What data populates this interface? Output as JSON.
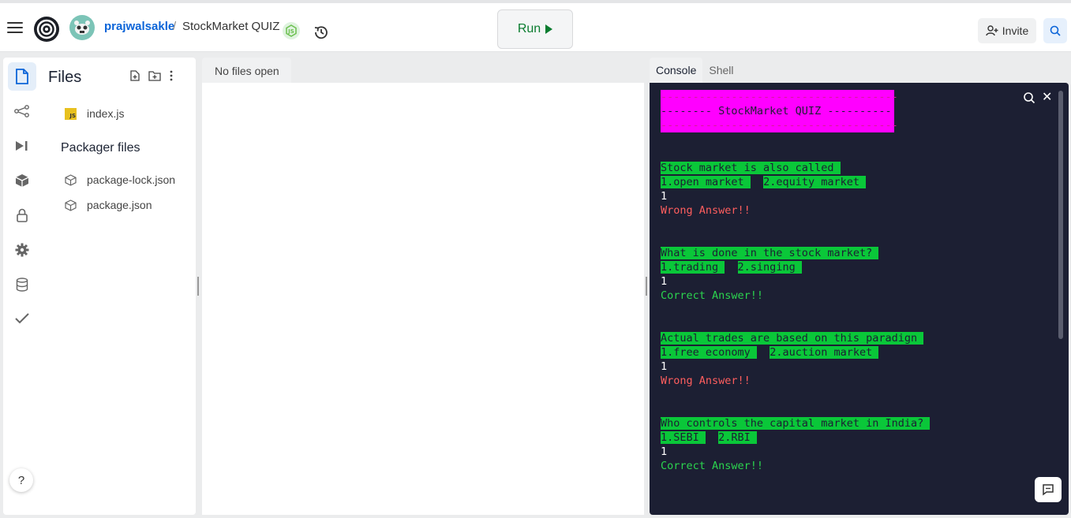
{
  "topbar": {
    "username": "prajwalsakle",
    "separator": "/",
    "project_name": "StockMarket QUIZ",
    "run_label": "Run",
    "invite_label": "Invite",
    "icons": [
      "menu-icon",
      "replit-logo",
      "nodejs-icon",
      "history-icon",
      "play-icon",
      "add-user-icon",
      "search-icon"
    ]
  },
  "sidebar": {
    "title": "Files",
    "rail_icons": [
      "file-icon",
      "share-icon",
      "debugger-icon",
      "packages-icon",
      "lock-icon",
      "gear-icon",
      "database-icon",
      "check-icon"
    ],
    "files": [
      {
        "name": "index.js",
        "icon": "js-icon"
      }
    ],
    "packager_title": "Packager files",
    "packager_files": [
      {
        "name": "package-lock.json",
        "icon": "cube-icon"
      },
      {
        "name": "package.json",
        "icon": "cube-icon"
      }
    ],
    "help_label": "?"
  },
  "editor": {
    "tab_label": "No files open"
  },
  "console": {
    "tabs": [
      "Console",
      "Shell"
    ],
    "active_tab": "Console",
    "header_lines": [
      "-------------------------------------",
      "-------- StockMarket QUIZ ----------",
      "-------------------------------------"
    ],
    "questions": [
      {
        "question": "Stock market is also called ",
        "opt1": "1.open market ",
        "opt2": "2.equity market ",
        "answer": "1",
        "result": "Wrong Answer!!",
        "correct": false
      },
      {
        "question": "What is done in the stock market? ",
        "opt1": "1.trading ",
        "opt2": "2.singing ",
        "answer": "1",
        "result": "Correct Answer!!",
        "correct": true
      },
      {
        "question": "Actual trades are based on this paradign ",
        "opt1": "1.free economy ",
        "opt2": "2.auction market ",
        "answer": "1",
        "result": "Wrong Answer!!",
        "correct": false
      },
      {
        "question": "Who controls the capital market in India? ",
        "opt1": "1.SEBI ",
        "opt2": "2.RBI ",
        "answer": "1",
        "result": "Correct Answer!!",
        "correct": true
      }
    ]
  },
  "colors": {
    "accent_blue": "#0b64d8",
    "run_green": "#0a7c2f",
    "console_bg": "#1c1f33",
    "highlight_green": "#0ac739",
    "magenta": "#ff00ff",
    "wrong_red": "#ff5e5e",
    "correct_green": "#2bd34e"
  }
}
